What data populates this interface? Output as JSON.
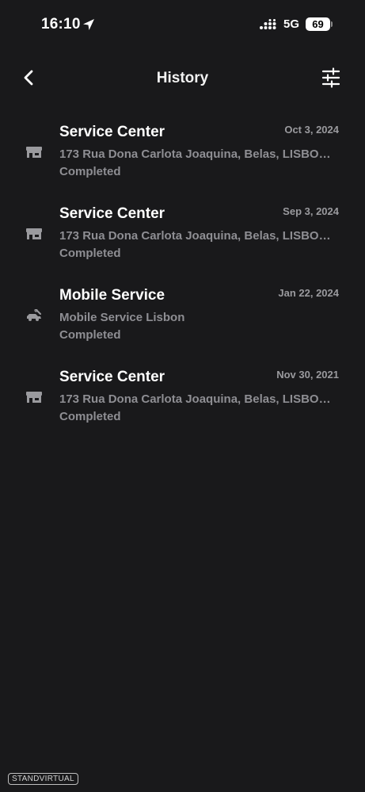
{
  "status_bar": {
    "time": "16:10",
    "network": "5G",
    "battery": "69"
  },
  "header": {
    "title": "History",
    "back_icon": "chevron-left-icon",
    "filter_icon": "sliders-icon"
  },
  "history": [
    {
      "icon": "service-center-icon",
      "title": "Service Center",
      "date": "Oct 3, 2024",
      "address": "173 Rua Dona Carlota Joaquina, Belas, LISBOA...",
      "status": "Completed"
    },
    {
      "icon": "service-center-icon",
      "title": "Service Center",
      "date": "Sep 3, 2024",
      "address": "173 Rua Dona Carlota Joaquina, Belas, LISBOA...",
      "status": "Completed"
    },
    {
      "icon": "mobile-service-icon",
      "title": "Mobile Service",
      "date": "Jan 22, 2024",
      "address": "Mobile Service Lisbon",
      "status": "Completed"
    },
    {
      "icon": "service-center-icon",
      "title": "Service Center",
      "date": "Nov 30, 2021",
      "address": "173 Rua Dona Carlota Joaquina, Belas, LISBOA...",
      "status": "Completed"
    }
  ],
  "watermark": "STANDVIRTUAL",
  "colors": {
    "background": "#19191b",
    "text_primary": "#ffffff",
    "text_secondary": "#8e8e93"
  }
}
